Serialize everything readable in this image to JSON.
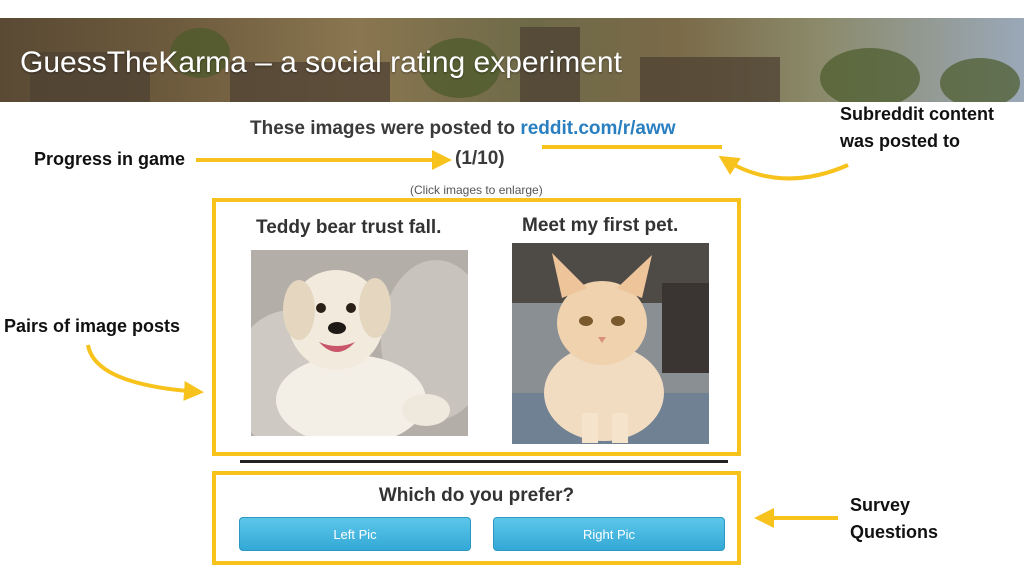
{
  "banner": {
    "title": "GuessTheKarma – a social rating experiment"
  },
  "header": {
    "prefix": "These images were posted to ",
    "link": "reddit.com/r/aww"
  },
  "progress": {
    "text": "(1/10)"
  },
  "hint": {
    "text": "(Click images to enlarge)"
  },
  "posts": [
    {
      "caption": "Teddy bear trust fall.",
      "image": "dog-photo"
    },
    {
      "caption": "Meet my first pet.",
      "image": "cat-photo"
    }
  ],
  "survey": {
    "question": "Which do you prefer?",
    "left_label": "Left Pic",
    "right_label": "Right Pic"
  },
  "annotations": {
    "progress": "Progress in game",
    "subreddit_line1": "Subreddit content",
    "subreddit_line2": "was posted to",
    "pairs": "Pairs of image posts",
    "survey_line1": "Survey",
    "survey_line2": "Questions"
  },
  "colors": {
    "highlight": "#f7c21b",
    "link": "#2a7fc0",
    "button": "#3fb4de"
  }
}
